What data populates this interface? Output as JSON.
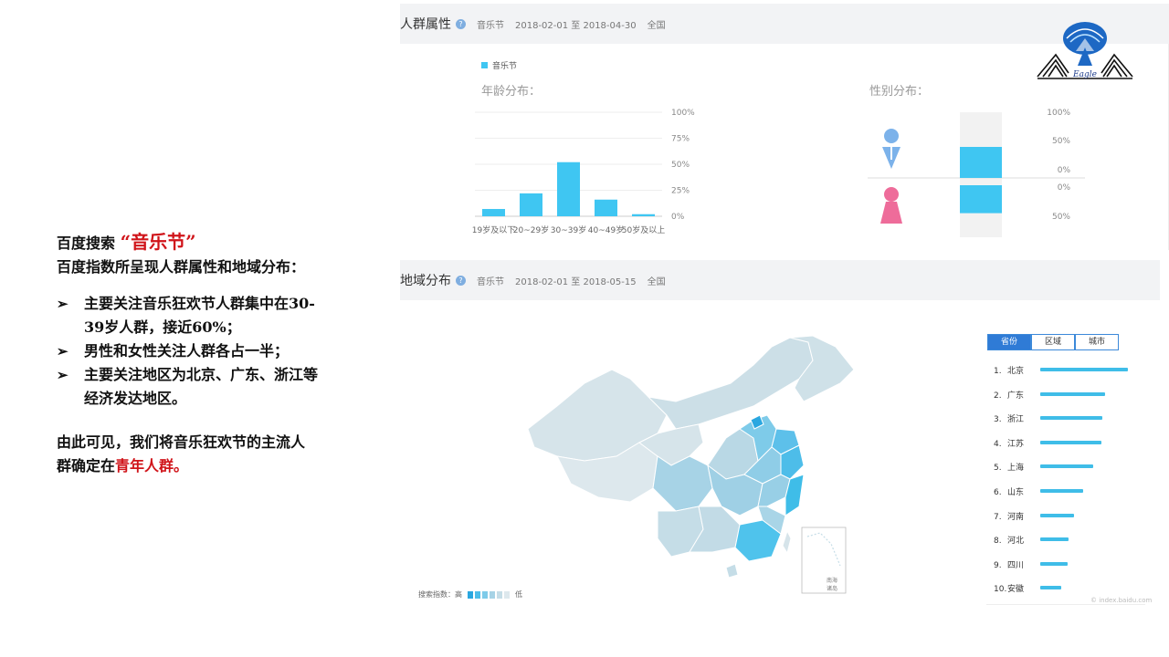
{
  "left_text": {
    "line1_prefix": "百度搜索",
    "line1_keyword": "“音乐节”",
    "line2": "百度指数所呈现人群属性和地域分布：",
    "bullets": [
      [
        "主要关注音乐狂欢节人群集中在30-",
        "39岁人群，接近60%；"
      ],
      [
        "男性和女性关注人群各占一半；"
      ],
      [
        "主要关注地区为北京、广东、浙江等",
        "经济发达地区。"
      ]
    ],
    "conclusion_line1": "由此可见，我们将音乐狂欢节的主流人",
    "conclusion_line2_prefix": "群确定在",
    "conclusion_highlight": "青年人群。"
  },
  "panel_crowd": {
    "title": "人群属性",
    "keyword": "音乐节",
    "date_range": "2018-02-01 至 2018-04-30",
    "region": "全国",
    "legend": "音乐节",
    "age_title": "年龄分布：",
    "gender_title": "性别分布："
  },
  "panel_region": {
    "title": "地域分布",
    "keyword": "音乐节",
    "date_range": "2018-02-01 至 2018-05-15",
    "region": "全国",
    "scale_label_high": "搜索指数：高",
    "scale_label_low": "低",
    "inset_label_1": "南海",
    "inset_label_2": "诸岛",
    "tabs": [
      "省份",
      "区域",
      "城市"
    ],
    "rankings": [
      {
        "rank": "1.",
        "name": "北京",
        "value": 100
      },
      {
        "rank": "2.",
        "name": "广东",
        "value": 74
      },
      {
        "rank": "3.",
        "name": "浙江",
        "value": 71
      },
      {
        "rank": "4.",
        "name": "江苏",
        "value": 70
      },
      {
        "rank": "5.",
        "name": "上海",
        "value": 60
      },
      {
        "rank": "6.",
        "name": "山东",
        "value": 49
      },
      {
        "rank": "7.",
        "name": "河南",
        "value": 39
      },
      {
        "rank": "8.",
        "name": "河北",
        "value": 32
      },
      {
        "rank": "9.",
        "name": "四川",
        "value": 31
      },
      {
        "rank": "10.",
        "name": "安徽",
        "value": 24
      }
    ],
    "watermark": "© index.baidu.com"
  },
  "logo_text": "Eagle",
  "chart_data": [
    {
      "type": "bar",
      "title": "年龄分布：",
      "categories": [
        "19岁及以下",
        "20~29岁",
        "30~39岁",
        "40~49岁",
        "50岁及以上"
      ],
      "series": [
        {
          "name": "音乐节",
          "values": [
            7,
            22,
            52,
            16,
            2
          ]
        }
      ],
      "y_ticks": [
        "100%",
        "75%",
        "50%",
        "25%",
        "0%"
      ],
      "ylim": [
        0,
        100
      ],
      "color": "#3fc6f2"
    },
    {
      "type": "bar",
      "title": "性别分布：",
      "categories": [
        "男",
        "女"
      ],
      "series": [
        {
          "name": "音乐节",
          "values": [
            50,
            50
          ]
        }
      ],
      "male_ticks": [
        "100%",
        "50%",
        "0%"
      ],
      "female_ticks": [
        "0%",
        "50%"
      ],
      "male_color": "#7cb2ea",
      "female_color": "#ee6c9a"
    }
  ]
}
